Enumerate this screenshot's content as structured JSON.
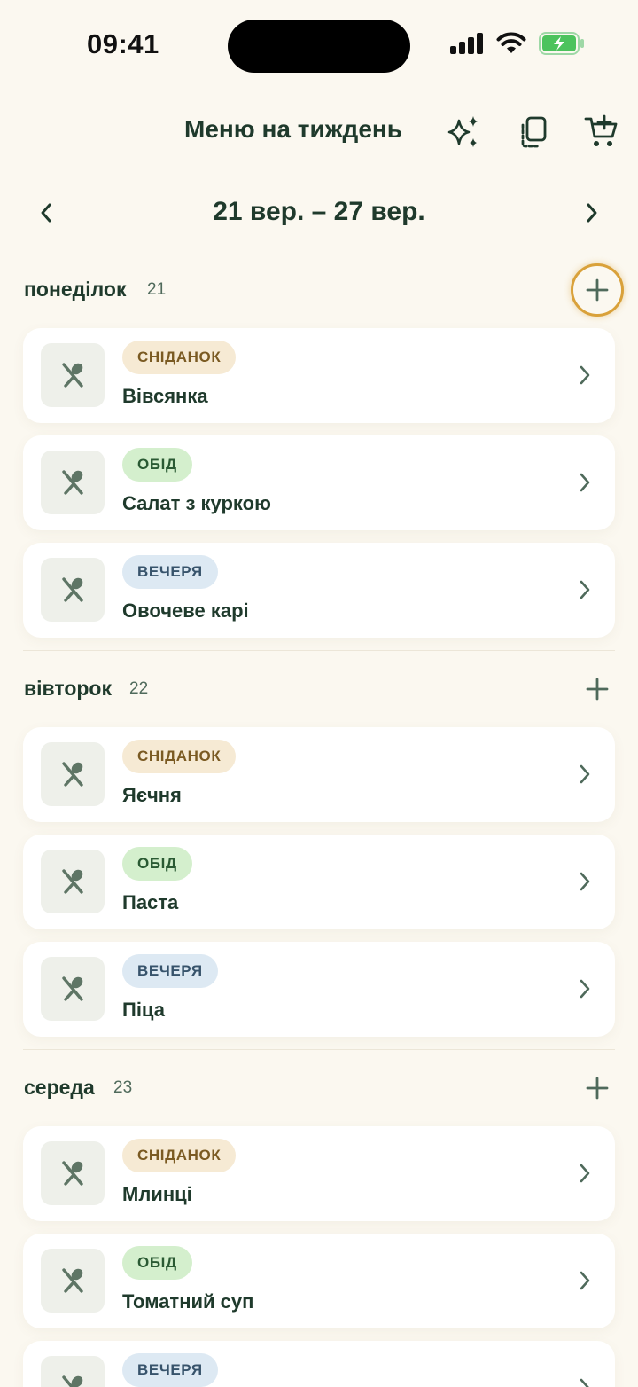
{
  "status": {
    "time": "09:41",
    "icons": [
      "cellular-signal-icon",
      "wifi-icon",
      "battery-charging-icon"
    ]
  },
  "header": {
    "title": "Меню на тиждень",
    "actions": [
      "sparkle-icon",
      "copy-icon",
      "cart-add-icon"
    ]
  },
  "week": {
    "label": "21 вер. – 27 вер.",
    "prev_icon": "chevron-left-icon",
    "next_icon": "chevron-right-icon"
  },
  "days": [
    {
      "name": "понеділок",
      "num": "21",
      "add_highlighted": true,
      "meals": [
        {
          "type": "СНІДАНОК",
          "kind": "breakfast",
          "name": "Вівсянка"
        },
        {
          "type": "ОБІД",
          "kind": "lunch",
          "name": "Салат з куркою"
        },
        {
          "type": "ВЕЧЕРЯ",
          "kind": "dinner",
          "name": "Овочеве карі"
        }
      ]
    },
    {
      "name": "вівторок",
      "num": "22",
      "add_highlighted": false,
      "meals": [
        {
          "type": "СНІДАНОК",
          "kind": "breakfast",
          "name": "Яєчня"
        },
        {
          "type": "ОБІД",
          "kind": "lunch",
          "name": "Паста"
        },
        {
          "type": "ВЕЧЕРЯ",
          "kind": "dinner",
          "name": "Піца"
        }
      ]
    },
    {
      "name": "середа",
      "num": "23",
      "add_highlighted": false,
      "meals": [
        {
          "type": "СНІДАНОК",
          "kind": "breakfast",
          "name": "Млинці"
        },
        {
          "type": "ОБІД",
          "kind": "lunch",
          "name": "Томатний суп"
        },
        {
          "type": "ВЕЧЕРЯ",
          "kind": "dinner",
          "name": ""
        }
      ]
    }
  ],
  "colors": {
    "background": "#fbf8f0",
    "text": "#1f3a2c",
    "highlight_ring": "#d9a13a",
    "battery": "#4cc35d"
  }
}
